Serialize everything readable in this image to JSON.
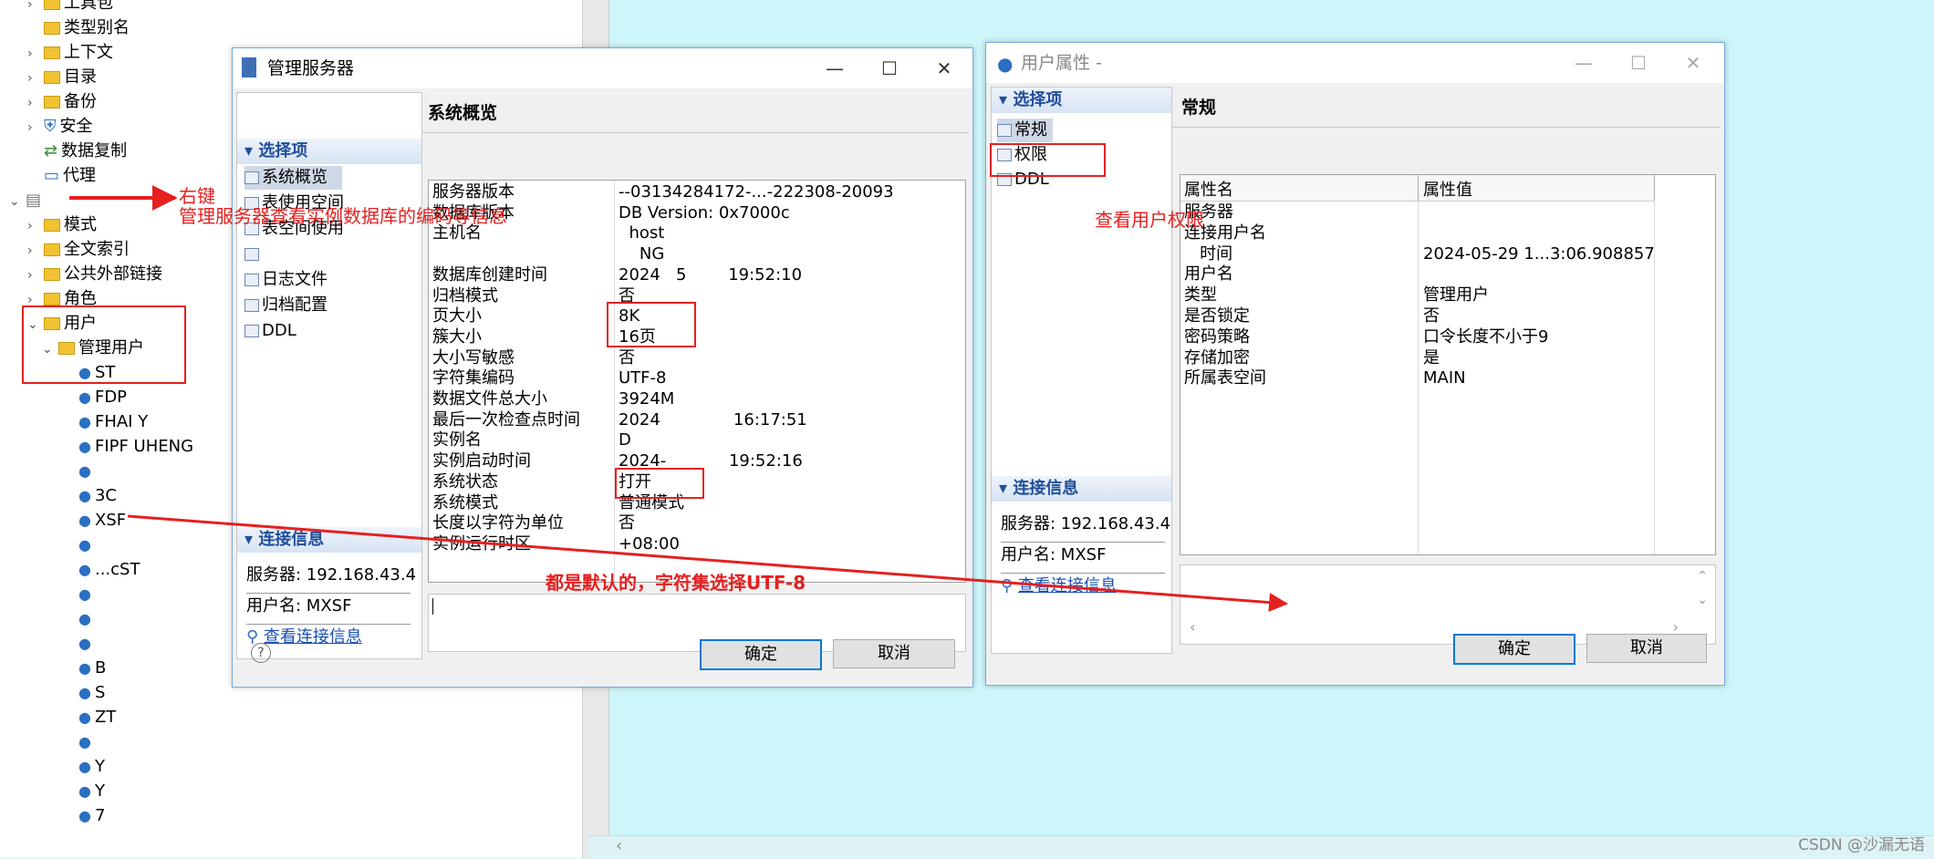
{
  "tree": {
    "items": [
      {
        "label": "工具包",
        "type": "folder",
        "arrow": "›"
      },
      {
        "label": "类型别名",
        "type": "folder",
        "arrow": ""
      },
      {
        "label": "上下文",
        "type": "folder",
        "arrow": "›"
      },
      {
        "label": "目录",
        "type": "folder",
        "arrow": "›"
      },
      {
        "label": "备份",
        "type": "folder",
        "arrow": "›"
      },
      {
        "label": "安全",
        "type": "shield",
        "arrow": "›"
      },
      {
        "label": "数据复制",
        "type": "replicate",
        "arrow": ""
      },
      {
        "label": "代理",
        "type": "proxy",
        "arrow": ""
      },
      {
        "label": "",
        "type": "db",
        "arrow": "⌄"
      },
      {
        "label": "模式",
        "type": "folder",
        "arrow": "›"
      },
      {
        "label": "全文索引",
        "type": "folder",
        "arrow": "›"
      },
      {
        "label": "公共外部链接",
        "type": "folder",
        "arrow": "›"
      },
      {
        "label": "角色",
        "type": "folder",
        "arrow": "›"
      },
      {
        "label": "用户",
        "type": "folder-open",
        "arrow": "⌄"
      },
      {
        "label": "管理用户",
        "type": "folder-open",
        "arrow": "⌄"
      }
    ],
    "users": [
      "ST",
      "FDP",
      "FHAI Y",
      "FIPF UHENG",
      "",
      "3C",
      "XSF",
      "",
      "...cST",
      "",
      "",
      "",
      "B",
      "S",
      "ZT",
      "",
      "Y",
      "Y",
      "7"
    ]
  },
  "server_dialog": {
    "title": "管理服务器",
    "nav_section": "选择项",
    "nav_items": [
      "系统概览",
      "表使用空间",
      "表空间使用",
      "",
      "日志文件",
      "归档配置",
      "DDL"
    ],
    "conn_section": "连接信息",
    "server_label": "服务器: 192.168.43.4",
    "user_label": "用户名: MXSF",
    "conn_link": "查看连接信息",
    "content_title": "系统概览",
    "rows": [
      {
        "k": "服务器版本",
        "v": "--03134284172-...-222308-20093"
      },
      {
        "k": "数据库版本",
        "v": "DB Version: 0x7000c"
      },
      {
        "k": "主机名",
        "v": "  host"
      },
      {
        "k": "",
        "v": "    NG"
      },
      {
        "k": "数据库创建时间",
        "v": "2024   5        19:52:10"
      },
      {
        "k": "归档模式",
        "v": "否"
      },
      {
        "k": "页大小",
        "v": "8K"
      },
      {
        "k": "簇大小",
        "v": "16页"
      },
      {
        "k": "大小写敏感",
        "v": "否"
      },
      {
        "k": "字符集编码",
        "v": "UTF-8"
      },
      {
        "k": "数据文件总大小",
        "v": "3924M"
      },
      {
        "k": "最后一次检查点时间",
        "v": "2024              16:17:51"
      },
      {
        "k": "实例名",
        "v": "D"
      },
      {
        "k": "实例启动时间",
        "v": "2024-            19:52:16"
      },
      {
        "k": "系统状态",
        "v": "打开"
      },
      {
        "k": "系统模式",
        "v": "普通模式"
      },
      {
        "k": "长度以字符为单位",
        "v": "否"
      },
      {
        "k": "实例运行时区",
        "v": "+08:00"
      }
    ],
    "ok": "确定",
    "cancel": "取消",
    "help": "?"
  },
  "user_dialog": {
    "title": "用户属性 -",
    "nav_section": "选择项",
    "nav_items": [
      "常规",
      "权限",
      "DDL"
    ],
    "conn_section": "连接信息",
    "server_label": "服务器: 192.168.43.4",
    "user_label": "用户名: MXSF",
    "conn_link": "查看连接信息",
    "content_title": "常规",
    "col_name": "属性名",
    "col_value": "属性值",
    "rows": [
      {
        "k": "服务器",
        "v": ""
      },
      {
        "k": "连接用户名",
        "v": ""
      },
      {
        "k": "   时间",
        "v": "2024-05-29 1...3:06.908857"
      },
      {
        "k": "用户名",
        "v": ""
      },
      {
        "k": "类型",
        "v": "管理用户"
      },
      {
        "k": "是否锁定",
        "v": "否"
      },
      {
        "k": "密码策略",
        "v": "口令长度不小于9"
      },
      {
        "k": "存储加密",
        "v": "是"
      },
      {
        "k": "所属表空间",
        "v": "MAIN"
      }
    ],
    "ok": "确定",
    "cancel": "取消"
  },
  "annotations": {
    "right_click": "右键",
    "manage_server": "管理服务器查看实例数据库的编码等信息",
    "view_perms": "查看用户权限",
    "defaults": "都是默认的，字符集选择UTF-8"
  },
  "watermark": "CSDN @沙漏无语",
  "colors": {
    "background": "#ccf6fa",
    "annotation": "#e52020",
    "accent": "#0078d7"
  }
}
